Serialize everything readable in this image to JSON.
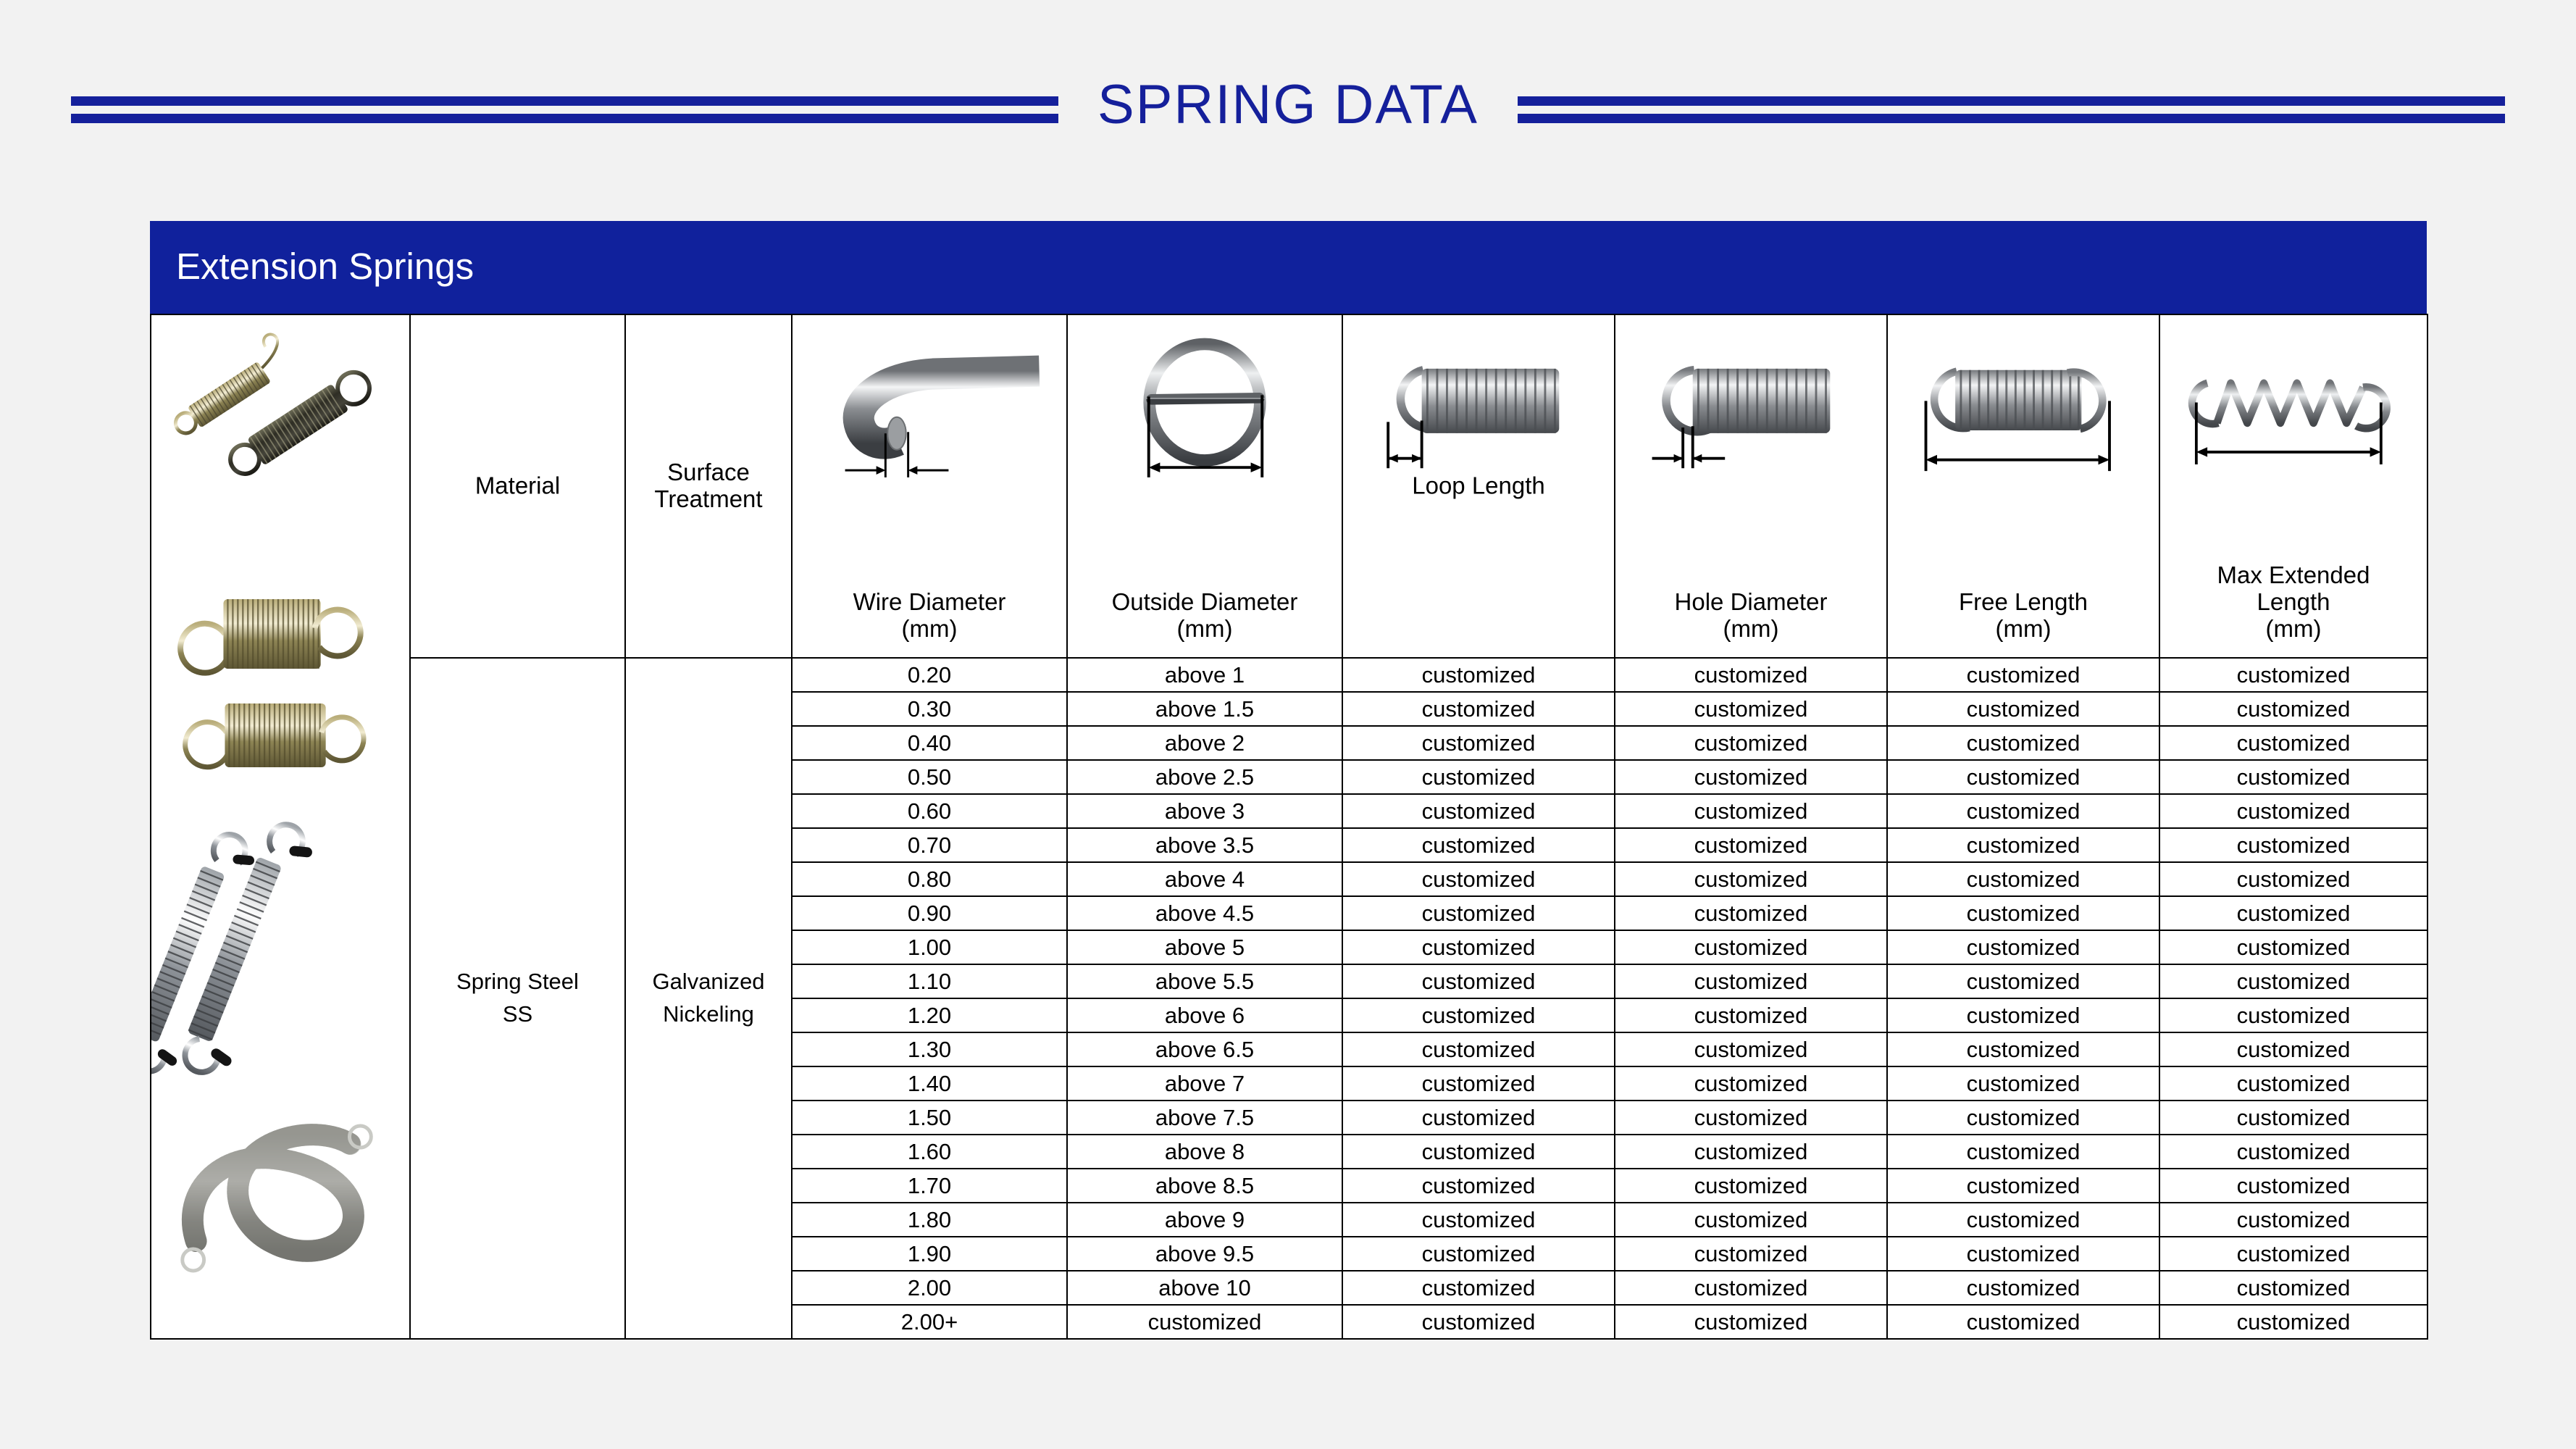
{
  "page": {
    "title": "SPRING  DATA",
    "background_color": "#f2f2f2",
    "accent_color": "#15209b"
  },
  "card": {
    "header_title": "Extension Springs",
    "header_bg": "#10219c",
    "header_text_color": "#ffffff"
  },
  "table": {
    "columns": [
      {
        "key": "photos",
        "label": "",
        "unit": "",
        "icon": "spring-photos"
      },
      {
        "key": "material",
        "label": "Material",
        "unit": "",
        "icon": ""
      },
      {
        "key": "surface",
        "label": "Surface",
        "unit": "",
        "label2": "Treatment",
        "icon": ""
      },
      {
        "key": "wire",
        "label": "Wire Diameter",
        "unit": "(mm)",
        "icon": "wire-diameter-diagram"
      },
      {
        "key": "od",
        "label": "Outside Diameter",
        "unit": "(mm)",
        "icon": "outside-diameter-diagram"
      },
      {
        "key": "loop",
        "label": "Loop Length",
        "unit": "",
        "icon": "loop-length-diagram"
      },
      {
        "key": "hole",
        "label": "Hole Diameter",
        "unit": "(mm)",
        "icon": "hole-diameter-diagram"
      },
      {
        "key": "free",
        "label": "Free Length",
        "unit": "(mm)",
        "icon": "free-length-diagram"
      },
      {
        "key": "max",
        "label": "Max Extended",
        "unit": "(mm)",
        "label2": "Length",
        "icon": "max-extended-length-diagram"
      }
    ],
    "material": "Spring Steel",
    "material_line2": "SS",
    "surface": "Galvanized",
    "surface_line2": "Nickeling",
    "customized_label": "customized",
    "rows": [
      {
        "wire": "0.20",
        "od": "above 1",
        "loop": "customized",
        "hole": "customized",
        "free": "customized",
        "max": "customized"
      },
      {
        "wire": "0.30",
        "od": "above 1.5",
        "loop": "customized",
        "hole": "customized",
        "free": "customized",
        "max": "customized"
      },
      {
        "wire": "0.40",
        "od": "above 2",
        "loop": "customized",
        "hole": "customized",
        "free": "customized",
        "max": "customized"
      },
      {
        "wire": "0.50",
        "od": "above 2.5",
        "loop": "customized",
        "hole": "customized",
        "free": "customized",
        "max": "customized"
      },
      {
        "wire": "0.60",
        "od": "above 3",
        "loop": "customized",
        "hole": "customized",
        "free": "customized",
        "max": "customized"
      },
      {
        "wire": "0.70",
        "od": "above 3.5",
        "loop": "customized",
        "hole": "customized",
        "free": "customized",
        "max": "customized"
      },
      {
        "wire": "0.80",
        "od": "above 4",
        "loop": "customized",
        "hole": "customized",
        "free": "customized",
        "max": "customized"
      },
      {
        "wire": "0.90",
        "od": "above 4.5",
        "loop": "customized",
        "hole": "customized",
        "free": "customized",
        "max": "customized"
      },
      {
        "wire": "1.00",
        "od": "above 5",
        "loop": "customized",
        "hole": "customized",
        "free": "customized",
        "max": "customized"
      },
      {
        "wire": "1.10",
        "od": "above 5.5",
        "loop": "customized",
        "hole": "customized",
        "free": "customized",
        "max": "customized"
      },
      {
        "wire": "1.20",
        "od": "above 6",
        "loop": "customized",
        "hole": "customized",
        "free": "customized",
        "max": "customized"
      },
      {
        "wire": "1.30",
        "od": "above 6.5",
        "loop": "customized",
        "hole": "customized",
        "free": "customized",
        "max": "customized"
      },
      {
        "wire": "1.40",
        "od": "above 7",
        "loop": "customized",
        "hole": "customized",
        "free": "customized",
        "max": "customized"
      },
      {
        "wire": "1.50",
        "od": "above 7.5",
        "loop": "customized",
        "hole": "customized",
        "free": "customized",
        "max": "customized"
      },
      {
        "wire": "1.60",
        "od": "above 8",
        "loop": "customized",
        "hole": "customized",
        "free": "customized",
        "max": "customized"
      },
      {
        "wire": "1.70",
        "od": "above 8.5",
        "loop": "customized",
        "hole": "customized",
        "free": "customized",
        "max": "customized"
      },
      {
        "wire": "1.80",
        "od": "above 9",
        "loop": "customized",
        "hole": "customized",
        "free": "customized",
        "max": "customized"
      },
      {
        "wire": "1.90",
        "od": "above 9.5",
        "loop": "customized",
        "hole": "customized",
        "free": "customized",
        "max": "customized"
      },
      {
        "wire": "2.00",
        "od": "above 10",
        "loop": "customized",
        "hole": "customized",
        "free": "customized",
        "max": "customized"
      },
      {
        "wire": "2.00+",
        "od": "customized",
        "loop": "customized",
        "hole": "customized",
        "free": "customized",
        "max": "customized"
      }
    ]
  }
}
